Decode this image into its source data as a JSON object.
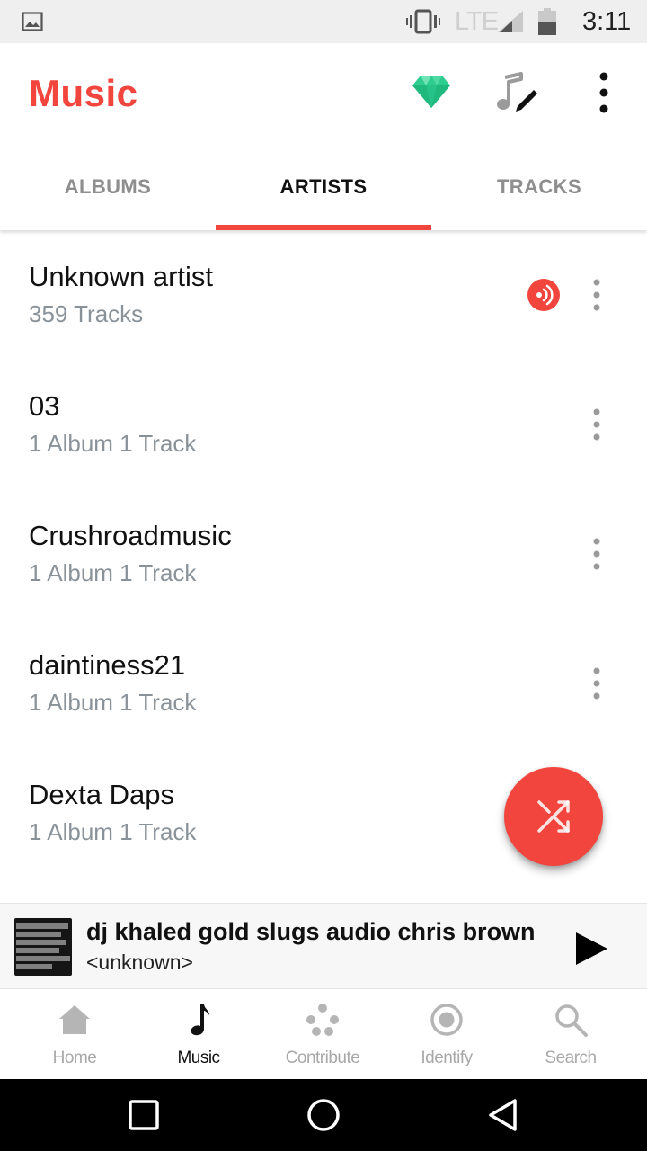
{
  "status_bar": {
    "network": "LTE",
    "time": "3:11"
  },
  "app_bar": {
    "title": "Music",
    "icons": [
      "diamond-icon",
      "lyrics-edit-icon",
      "more-vert-icon"
    ]
  },
  "tabs": [
    {
      "label": "ALBUMS",
      "active": false
    },
    {
      "label": "ARTISTS",
      "active": true
    },
    {
      "label": "TRACKS",
      "active": false
    }
  ],
  "artists": [
    {
      "name": "Unknown artist",
      "subtitle": "359 Tracks",
      "live": true
    },
    {
      "name": "03",
      "subtitle": "1 Album 1 Track",
      "live": false
    },
    {
      "name": "Crushroadmusic",
      "subtitle": "1 Album 1 Track",
      "live": false
    },
    {
      "name": "daintiness21",
      "subtitle": "1 Album 1 Track",
      "live": false
    },
    {
      "name": "Dexta Daps",
      "subtitle": "1 Album 1 Track",
      "live": false
    }
  ],
  "fab": {
    "icon": "shuffle-icon"
  },
  "now_playing": {
    "title": "dj khaled gold slugs audio chris brown",
    "artist": "<unknown>"
  },
  "bottom_nav": [
    {
      "label": "Home",
      "icon": "home-icon",
      "active": false
    },
    {
      "label": "Music",
      "icon": "music-note-icon",
      "active": true
    },
    {
      "label": "Contribute",
      "icon": "contribute-icon",
      "active": false
    },
    {
      "label": "Identify",
      "icon": "identify-icon",
      "active": false
    },
    {
      "label": "Search",
      "icon": "search-icon",
      "active": false
    }
  ],
  "colors": {
    "accent": "#f2453d",
    "diamond": "#2ecc8f",
    "status_bar_bg": "#efefef",
    "system_nav_bg": "#000000"
  }
}
